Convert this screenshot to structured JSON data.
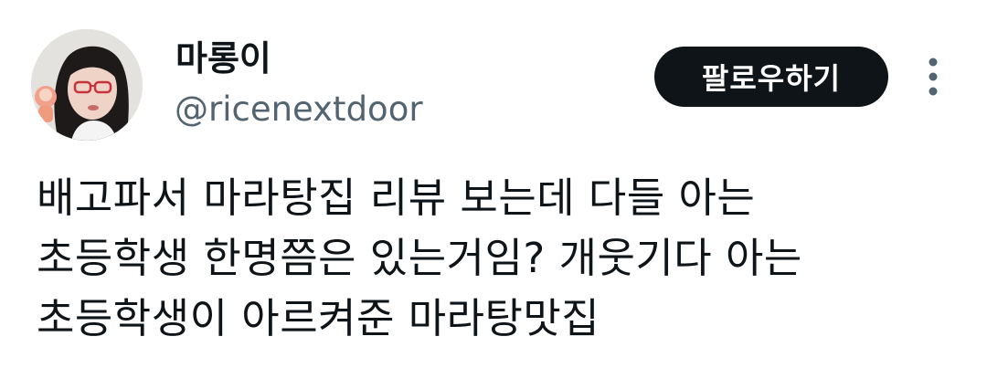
{
  "author": {
    "display_name": "마롱이",
    "handle": "@ricenextdoor"
  },
  "actions": {
    "follow_label": "팔로우하기"
  },
  "icons": {
    "more": "more-vertical-icon",
    "avatar": "profile-photo"
  },
  "tweet": {
    "lines": [
      "배고파서 마라탕집 리뷰 보는데 다들 아는",
      "초등학생 한명쯤은 있는거임?  개웃기다 아는",
      "초등학생이 아르켜준 마라탕맛집"
    ]
  },
  "colors": {
    "text": "#0f1419",
    "secondary_text": "#536471",
    "button_bg": "#0f1419",
    "button_text": "#ffffff",
    "more_icon": "#536471"
  }
}
